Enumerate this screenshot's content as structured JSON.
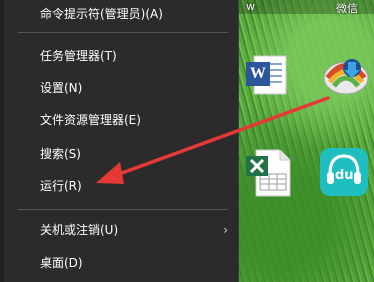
{
  "desktop": {
    "top_labels": [
      "w",
      "微信"
    ]
  },
  "menu": {
    "items": [
      {
        "label": "命令提示符(管理员)(A)",
        "has_submenu": false
      },
      {
        "label": "任务管理器(T)",
        "has_submenu": false
      },
      {
        "label": "设置(N)",
        "has_submenu": false
      },
      {
        "label": "文件资源管理器(E)",
        "has_submenu": false
      },
      {
        "label": "搜索(S)",
        "has_submenu": false
      },
      {
        "label": "运行(R)",
        "has_submenu": false
      },
      {
        "label": "关机或注销(U)",
        "has_submenu": true
      },
      {
        "label": "桌面(D)",
        "has_submenu": false
      }
    ],
    "submenu_arrow": "›"
  },
  "icons": {
    "word": "word-icon",
    "idm": "idm-icon",
    "excel": "excel-icon",
    "du": "du-icon",
    "du_text": "du",
    "word_letter": "W"
  },
  "colors": {
    "menu_bg": "#2b2b2b",
    "arrow": "#e53935",
    "word_blue": "#2b579a",
    "excel_green": "#217346",
    "du_teal": "#1fbfbf"
  }
}
